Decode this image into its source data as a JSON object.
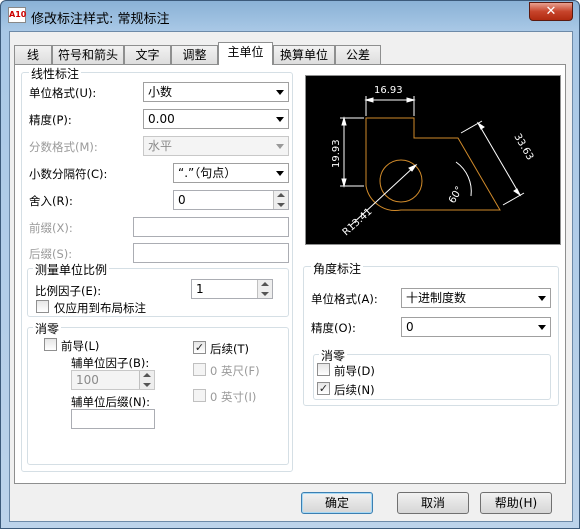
{
  "window": {
    "title": "修改标注样式: 常规标注",
    "close_label": "✕",
    "app_icon_text": "A10"
  },
  "tabs": [
    "线",
    "符号和箭头",
    "文字",
    "调整",
    "主单位",
    "换算单位",
    "公差"
  ],
  "linear": {
    "group_label": "线性标注",
    "unit_format_label": "单位格式(U):",
    "unit_format_value": "小数",
    "precision_label": "精度(P):",
    "precision_value": "0.00",
    "fraction_label": "分数格式(M):",
    "fraction_value": "水平",
    "decimal_sep_label": "小数分隔符(C):",
    "decimal_sep_value": "“.”（句点）",
    "roundoff_label": "舍入(R):",
    "roundoff_value": "0",
    "prefix_label": "前缀(X):",
    "prefix_value": "",
    "suffix_label": "后缀(S):",
    "suffix_value": ""
  },
  "scale": {
    "group_label": "测量单位比例",
    "factor_label": "比例因子(E):",
    "factor_value": "1",
    "layout_only_label": "仅应用到布局标注"
  },
  "zero_suppress": {
    "group_label": "消零",
    "leading_label": "前导(L)",
    "trailing_label": "后续(T)",
    "sub_factor_label": "辅单位因子(B):",
    "sub_factor_value": "100",
    "feet_label": "0 英尺(F)",
    "sub_suffix_label": "辅单位后缀(N):",
    "sub_suffix_value": "",
    "inches_label": "0 英寸(I)"
  },
  "angular": {
    "group_label": "角度标注",
    "unit_format_label": "单位格式(A):",
    "unit_format_value": "十进制度数",
    "precision_label": "精度(O):",
    "precision_value": "0",
    "zero_group_label": "消零",
    "leading_label": "前导(D)",
    "trailing_label": "后续(N)"
  },
  "preview": {
    "dim_top": "16.93",
    "dim_left": "19.93",
    "dim_right": "33.63",
    "dim_angle": "60°",
    "dim_radius": "R13.41"
  },
  "buttons": {
    "ok": "确定",
    "cancel": "取消",
    "help": "帮助(H)"
  },
  "colors": {
    "preview_bg": "#000000",
    "geometry": "#d08a2a",
    "dims": "#ffffff"
  }
}
